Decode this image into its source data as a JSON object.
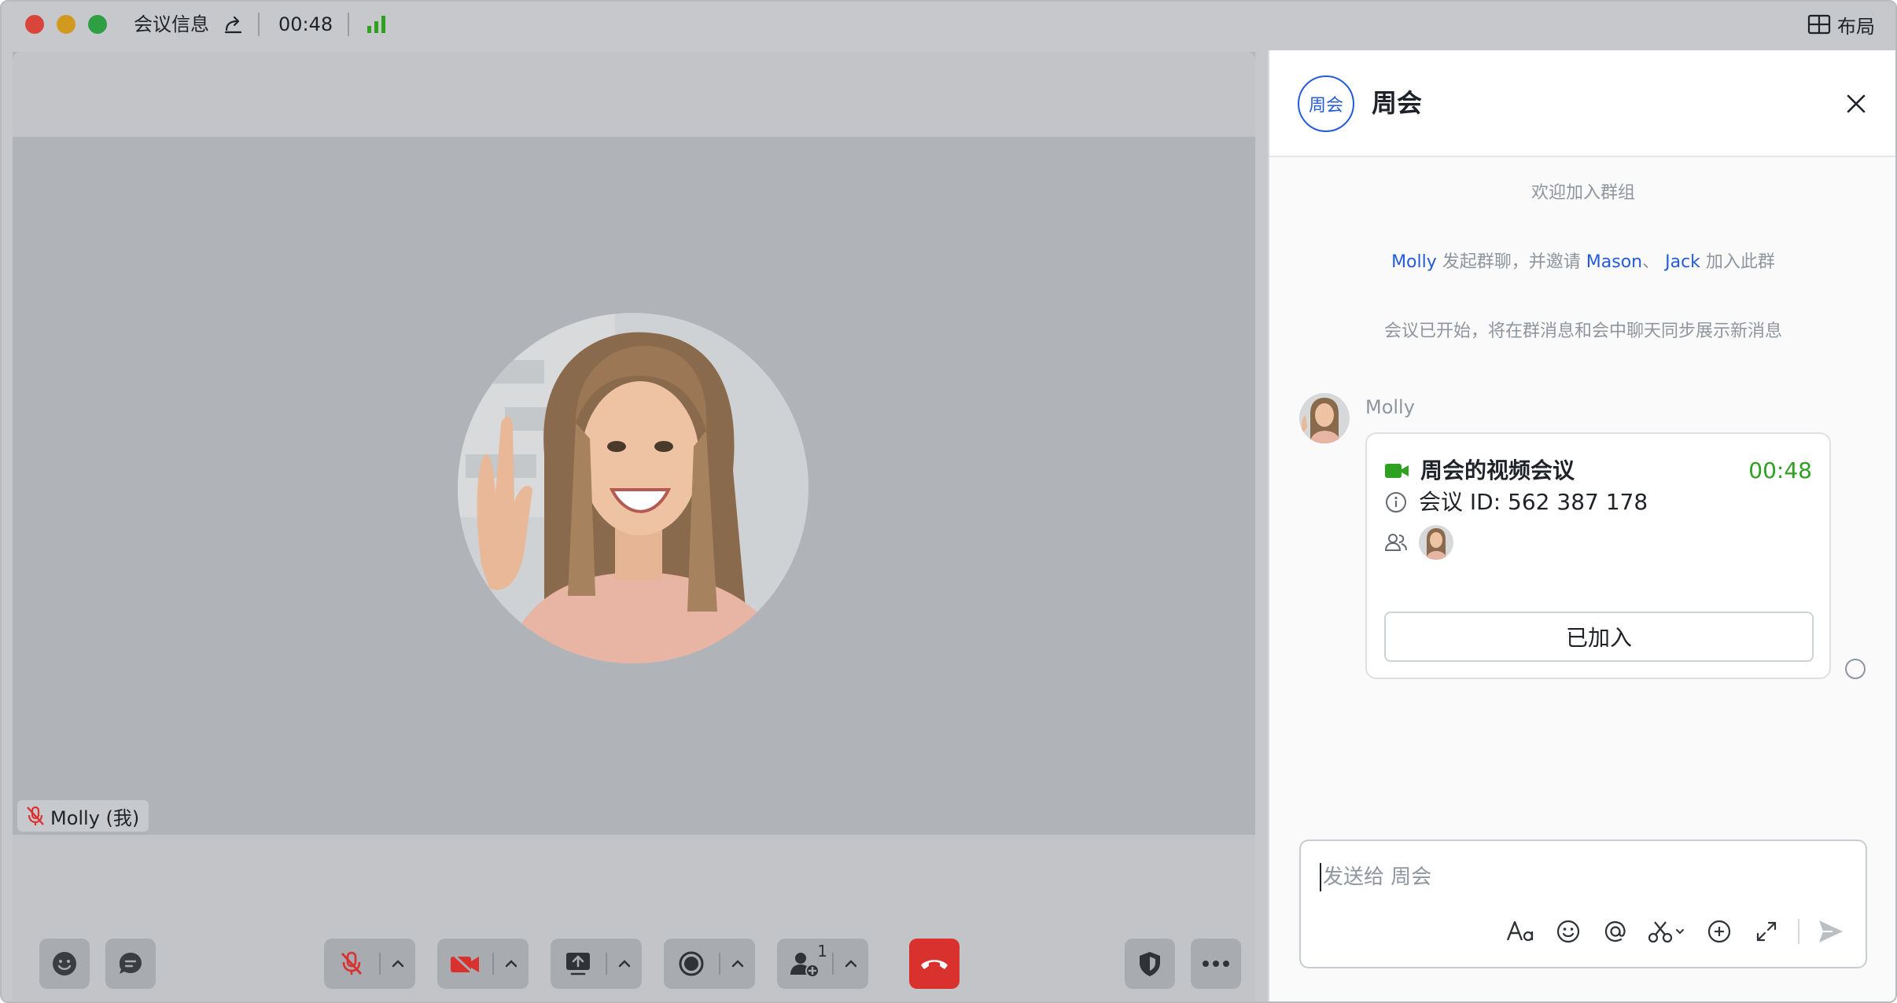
{
  "window": {
    "meeting_info_label": "会议信息",
    "timer": "00:48",
    "layout_label": "布局"
  },
  "video": {
    "participant_name": "Molly (我)"
  },
  "toolbar": {
    "participants_count": "1"
  },
  "chat": {
    "group_avatar_text": "周会",
    "title": "周会",
    "welcome": "欢迎加入群组",
    "invite_msg": {
      "inviter": "Molly",
      "middle": " 发起群聊，并邀请 ",
      "invitee1": "Mason",
      "sep": "、 ",
      "invitee2": "Jack",
      "end": " 加入此群"
    },
    "meeting_started": "会议已开始，将在群消息和会中聊天同步展示新消息",
    "message": {
      "sender": "Molly",
      "card": {
        "title": "周会的视频会议",
        "time": "00:48",
        "meeting_id": "会议 ID: 562 387 178",
        "joined_label": "已加入"
      }
    },
    "composer": {
      "placeholder": "发送给 周会"
    }
  },
  "colors": {
    "accent_blue": "#245bdb",
    "live_green": "#2ea121",
    "hangup_red": "#d9312e"
  }
}
